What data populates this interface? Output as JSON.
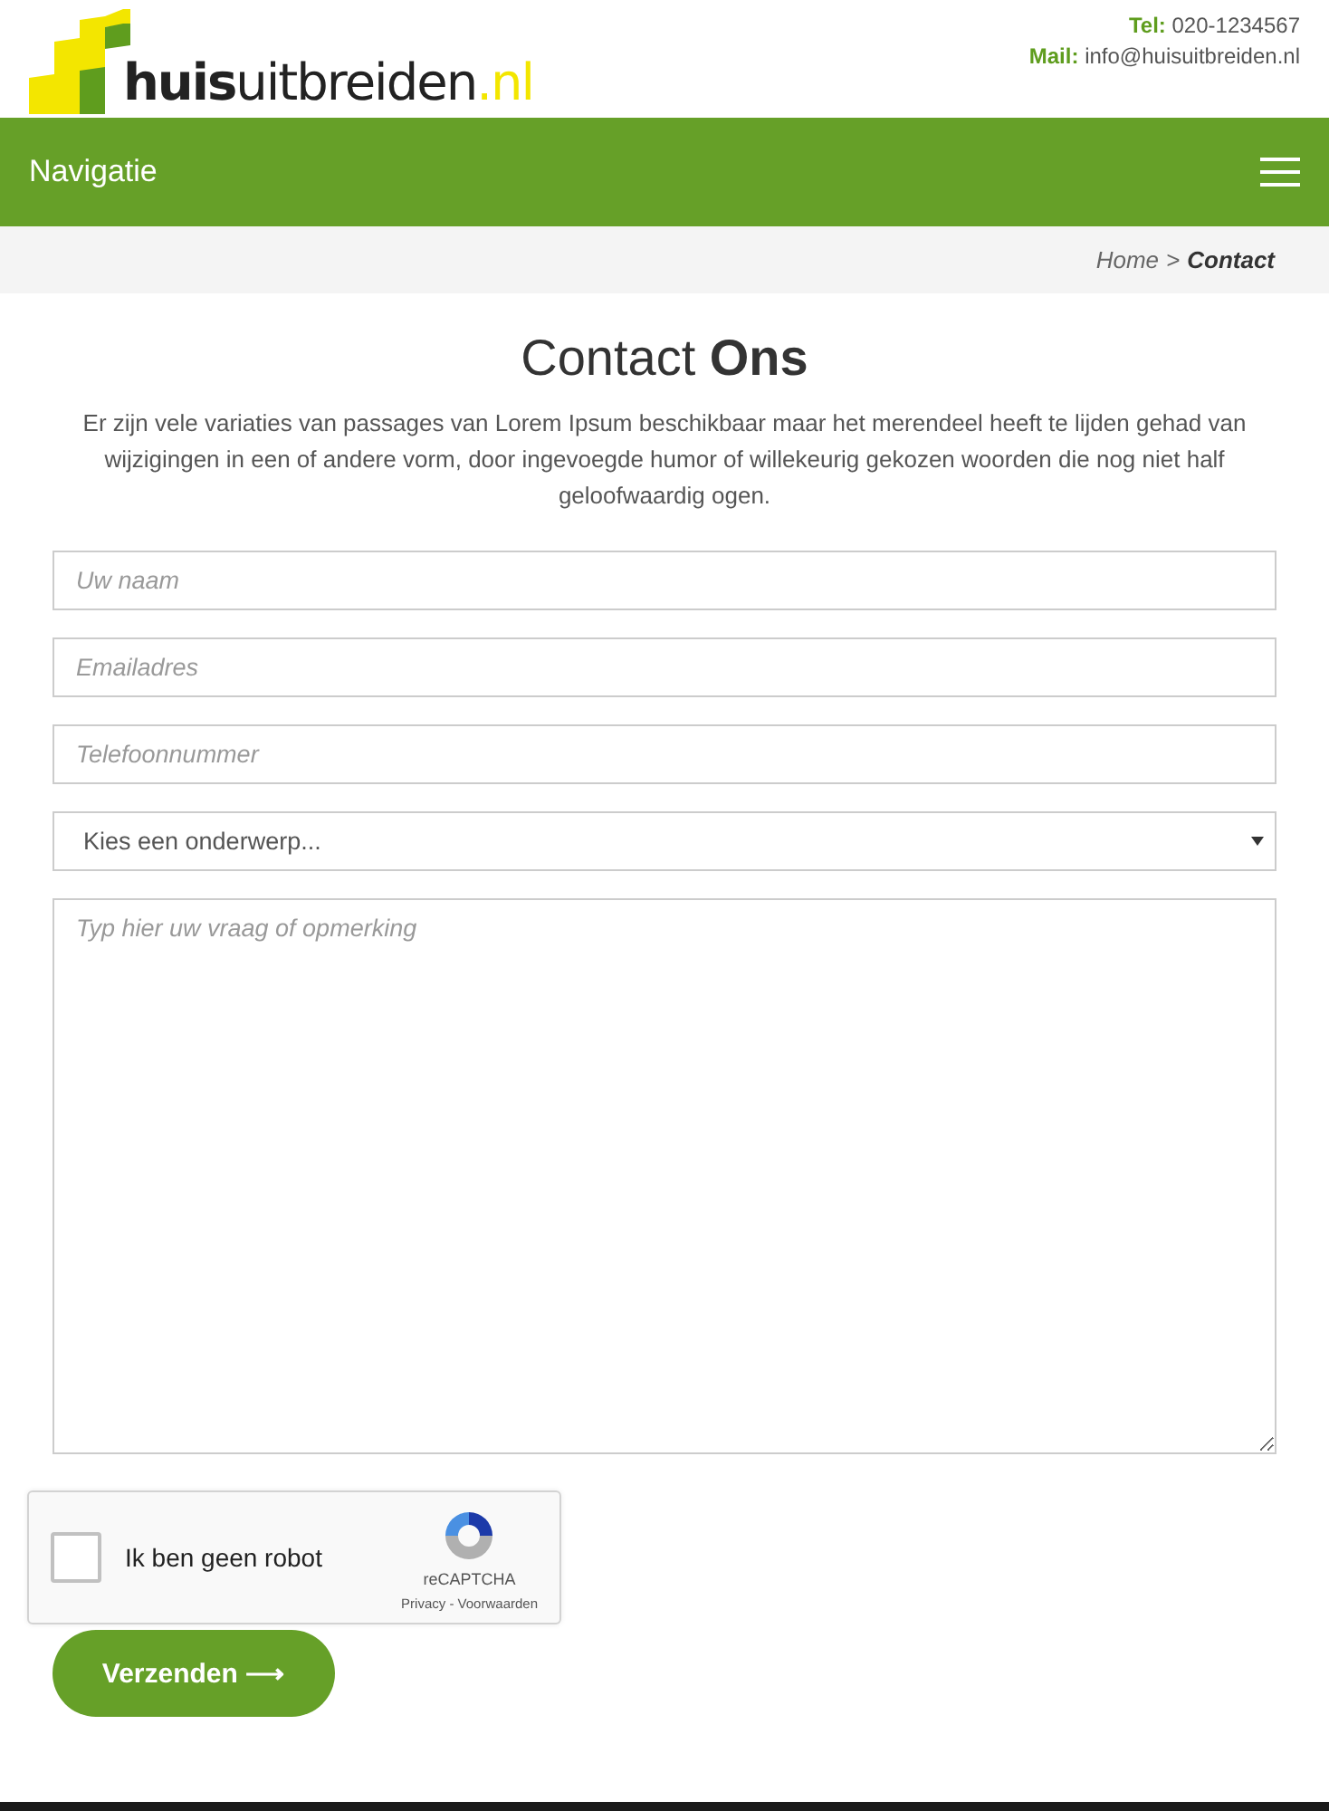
{
  "header": {
    "logo": {
      "bold": "huis",
      "regular": "uitbreiden",
      "suffix": ".nl"
    },
    "contact": [
      {
        "label": "Tel:",
        "value": "020-1234567"
      },
      {
        "label": "Mail:",
        "value": "info@huisuitbreiden.nl"
      }
    ]
  },
  "nav": {
    "title": "Navigatie"
  },
  "breadcrumb": {
    "home": "Home",
    "separator": ">",
    "current": "Contact"
  },
  "heading": "Contact **Ons**",
  "intro": "Er zijn vele variaties van passages van Lorem Ipsum beschikbaar maar het merendeel heeft te lijden gehad van wijzigingen in een of andere vorm, door ingevoegde humor of willekeurig gekozen woorden die nog niet half geloofwaardig ogen.",
  "fields": [
    {
      "kind": "input",
      "placeholder": "Uw naam"
    },
    {
      "kind": "input",
      "placeholder": "Emailadres"
    },
    {
      "kind": "input",
      "placeholder": "Telefoonnummer"
    },
    {
      "kind": "select",
      "value": "Kies een onderwerp..."
    },
    {
      "kind": "textarea",
      "placeholder": "Typ hier uw vraag of opmerking"
    }
  ],
  "captcha": {
    "label": "Ik ben geen robot",
    "checked": false,
    "brand": "reCAPTCHA",
    "links": "Privacy - Voorwaarden"
  },
  "submit": {
    "label": "Verzenden",
    "arrow": "⟶"
  }
}
